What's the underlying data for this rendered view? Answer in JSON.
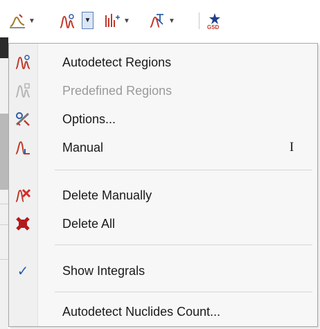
{
  "toolbar": {
    "icons": [
      "peak-tool-icon",
      "region-detect-icon",
      "peak-fit-icon",
      "nuclide-icon",
      "gsd-icon"
    ],
    "gsd_text": "GSD"
  },
  "menu": {
    "items": [
      {
        "label": "Autodetect Regions",
        "icon": "autodetect-regions-icon",
        "enabled": true
      },
      {
        "label": "Predefined Regions",
        "icon": "predefined-regions-icon",
        "enabled": false
      },
      {
        "label": "Options...",
        "icon": "options-icon",
        "enabled": true
      },
      {
        "label": "Manual",
        "icon": "manual-icon",
        "enabled": true,
        "shortcut": "I"
      },
      {
        "label": "Delete Manually",
        "icon": "delete-manually-icon",
        "enabled": true
      },
      {
        "label": "Delete All",
        "icon": "delete-all-icon",
        "enabled": true
      },
      {
        "label": "Show Integrals",
        "icon": "checkmark-icon",
        "enabled": true,
        "checked": true
      },
      {
        "label": "Autodetect Nuclides Count...",
        "enabled": true
      }
    ]
  },
  "colors": {
    "peak_icon": "#c0392b",
    "disabled_icon": "#b5b5b5",
    "accent_blue": "#2b5da8",
    "gsd_star": "#1f3f8f"
  }
}
